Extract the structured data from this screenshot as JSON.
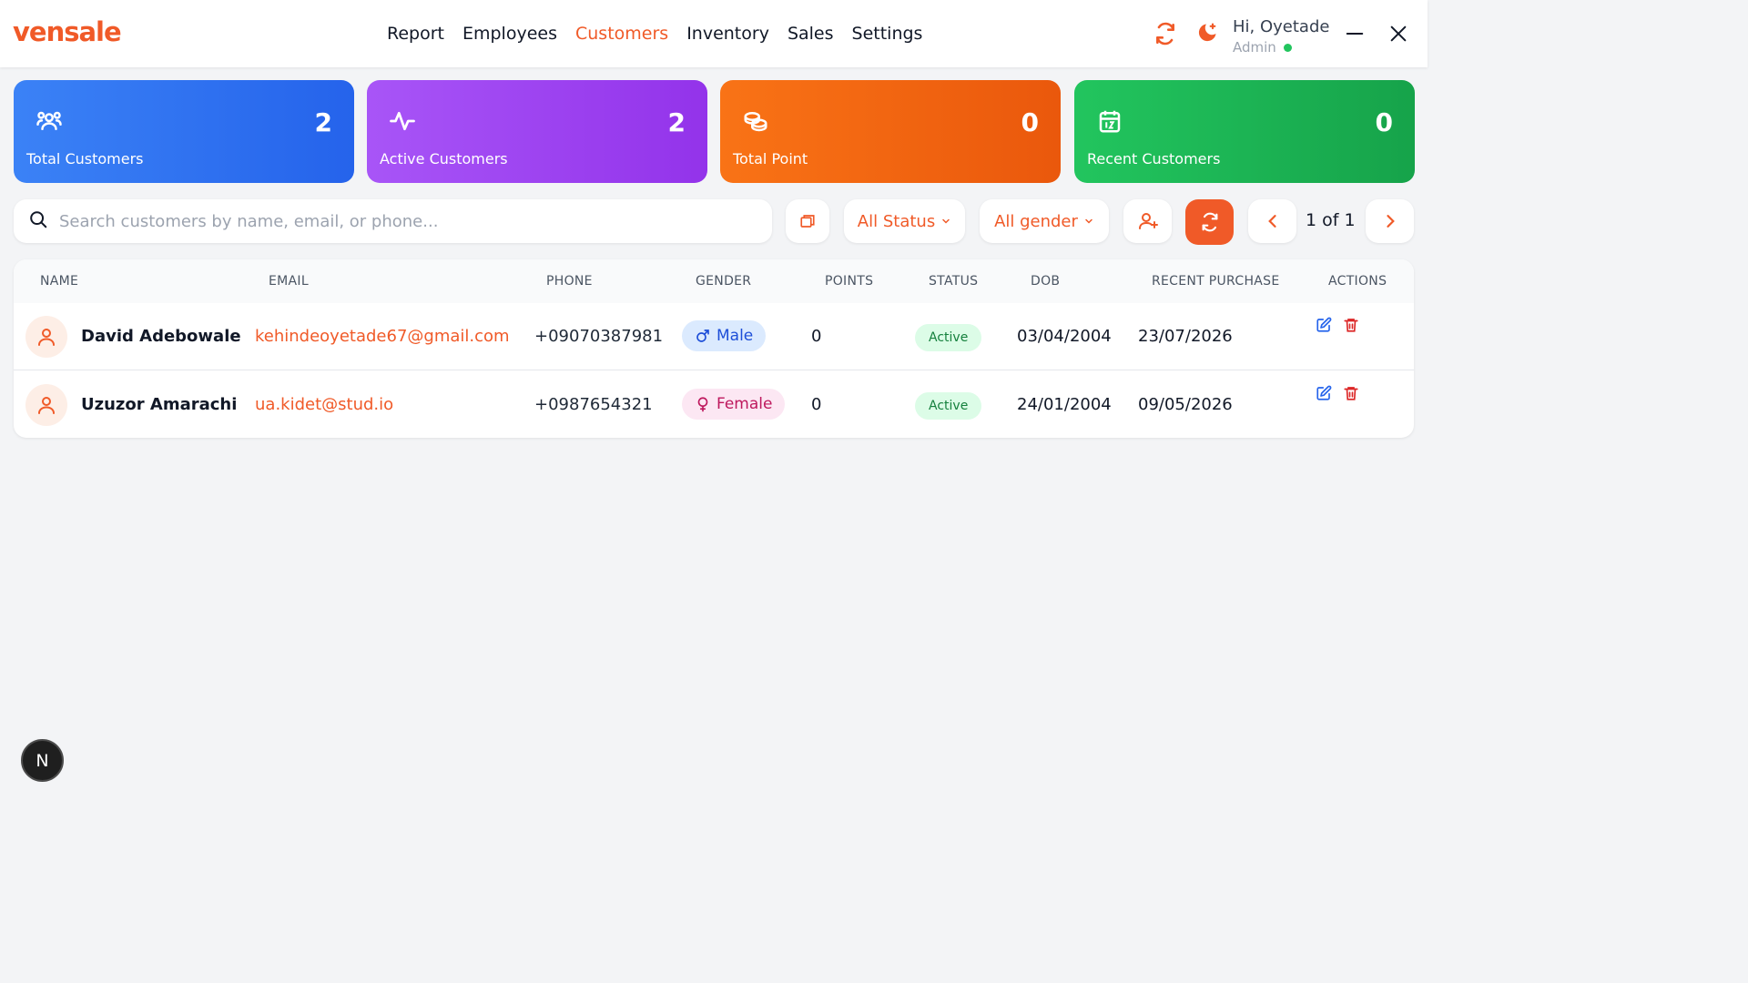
{
  "header": {
    "logo": "vensale",
    "nav": [
      "Report",
      "Employees",
      "Customers",
      "Inventory",
      "Sales",
      "Settings"
    ],
    "active_nav": "Customers",
    "greeting": "Hi, Oyetade",
    "role": "Admin"
  },
  "stats": [
    {
      "label": "Total Customers",
      "value": "2"
    },
    {
      "label": "Active Customers",
      "value": "2"
    },
    {
      "label": "Total Point",
      "value": "0"
    },
    {
      "label": "Recent Customers",
      "value": "0"
    }
  ],
  "toolbar": {
    "search_placeholder": "Search customers by name, email, or phone...",
    "status_filter": "All Status",
    "gender_filter": "All gender",
    "page_info": "1 of 1"
  },
  "table": {
    "columns": [
      "NAME",
      "EMAIL",
      "PHONE",
      "GENDER",
      "POINTS",
      "STATUS",
      "DOB",
      "RECENT PURCHASE",
      "ACTIONS"
    ],
    "rows": [
      {
        "name": "David Adebowale",
        "email": "kehindeoyetade67@gmail.com",
        "phone": "+09070387981",
        "gender": "Male",
        "points": "0",
        "status": "Active",
        "dob": "03/04/2004",
        "recent": "23/07/2026"
      },
      {
        "name": "Uzuzor Amarachi",
        "email": "ua.kidet@stud.io",
        "phone": "+0987654321",
        "gender": "Female",
        "points": "0",
        "status": "Active",
        "dob": "24/01/2004",
        "recent": "09/05/2026"
      }
    ]
  },
  "dev_badge": "N",
  "colors": {
    "brand": "#f05a28",
    "blue": "#2563eb",
    "purple": "#9333ea",
    "orange": "#ea580c",
    "green": "#16a34a"
  }
}
